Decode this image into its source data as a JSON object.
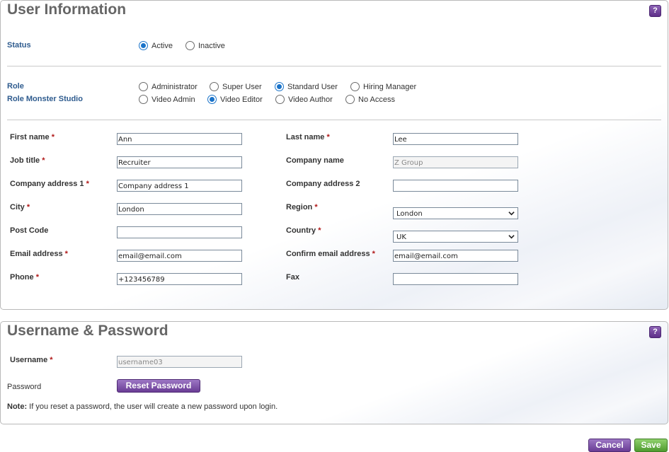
{
  "user_info": {
    "title": "User Information",
    "help_label": "?",
    "status": {
      "label": "Status",
      "options": [
        {
          "label": "Active",
          "selected": true
        },
        {
          "label": "Inactive",
          "selected": false
        }
      ]
    },
    "role": {
      "label": "Role",
      "options": [
        {
          "label": "Administrator",
          "selected": false
        },
        {
          "label": "Super User",
          "selected": false
        },
        {
          "label": "Standard User",
          "selected": true
        },
        {
          "label": "Hiring Manager",
          "selected": false
        }
      ]
    },
    "role_studio": {
      "label": "Role Monster Studio",
      "options": [
        {
          "label": "Video Admin",
          "selected": false
        },
        {
          "label": "Video Editor",
          "selected": true
        },
        {
          "label": "Video Author",
          "selected": false
        },
        {
          "label": "No Access",
          "selected": false
        }
      ]
    },
    "fields": {
      "first_name": {
        "label": "First name",
        "required": "*",
        "value": "Ann"
      },
      "last_name": {
        "label": "Last name",
        "required": "*",
        "value": "Lee"
      },
      "job_title": {
        "label": "Job title",
        "required": "*",
        "value": "Recruiter"
      },
      "company_name": {
        "label": "Company name",
        "value": "Z Group"
      },
      "company_address_1": {
        "label": "Company address 1",
        "required": "*",
        "value": "Company address 1"
      },
      "company_address_2": {
        "label": "Company address 2",
        "value": ""
      },
      "city": {
        "label": "City",
        "required": "*",
        "value": "London"
      },
      "region": {
        "label": "Region",
        "required": "*",
        "value": "London"
      },
      "post_code": {
        "label": "Post Code",
        "value": ""
      },
      "country": {
        "label": "Country",
        "required": "*",
        "value": "UK"
      },
      "email": {
        "label": "Email address",
        "required": "*",
        "value": "email@email.com"
      },
      "confirm_email": {
        "label": "Confirm email address",
        "required": "*",
        "value": "email@email.com"
      },
      "phone": {
        "label": "Phone",
        "required": "*",
        "value": "+123456789"
      },
      "fax": {
        "label": "Fax",
        "value": ""
      }
    }
  },
  "credentials": {
    "title": "Username & Password",
    "help_label": "?",
    "username": {
      "label": "Username",
      "required": "*",
      "value": "username03"
    },
    "password": {
      "label": "Password",
      "button": "Reset Password"
    },
    "note_prefix": "Note:",
    "note_text": " If you reset a password, the user will create a new password upon login."
  },
  "footer": {
    "cancel_label": "Cancel",
    "save_label": "Save"
  },
  "colors": {
    "accent_purple": "#6a3c95",
    "save_green": "#4f9a2f",
    "label_blue": "#2e5b8e",
    "required_red": "#b01818"
  }
}
